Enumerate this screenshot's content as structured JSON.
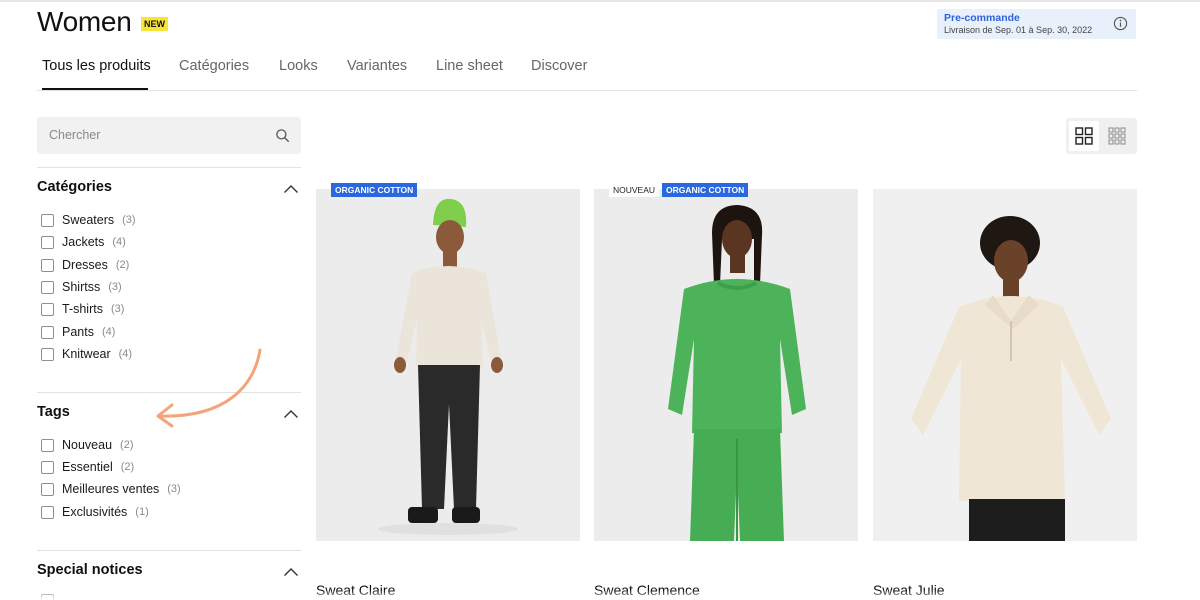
{
  "header": {
    "title": "Women",
    "new_badge": "NEW",
    "preorder": {
      "title": "Pre-commande",
      "subtitle": "Livraison de Sep. 01 à Sep. 30, 2022",
      "icon": "info-icon"
    }
  },
  "tabs": [
    {
      "label": "Tous les produits",
      "active": true
    },
    {
      "label": "Catégories",
      "active": false
    },
    {
      "label": "Looks",
      "active": false
    },
    {
      "label": "Variantes",
      "active": false
    },
    {
      "label": "Line sheet",
      "active": false
    },
    {
      "label": "Discover",
      "active": false
    }
  ],
  "sidebar": {
    "search": {
      "placeholder": "Chercher",
      "value": "",
      "icon": "search-icon"
    },
    "sections": [
      {
        "title": "Catégories",
        "items": [
          {
            "label": "Sweaters",
            "count": "(3)"
          },
          {
            "label": "Jackets",
            "count": "(4)"
          },
          {
            "label": "Dresses",
            "count": "(2)"
          },
          {
            "label": "Shirtss",
            "count": "(3)"
          },
          {
            "label": "T-shirts",
            "count": "(3)"
          },
          {
            "label": "Pants",
            "count": "(4)"
          },
          {
            "label": "Knitwear",
            "count": "(4)"
          }
        ]
      },
      {
        "title": "Tags",
        "items": [
          {
            "label": "Nouveau",
            "count": "(2)"
          },
          {
            "label": "Essentiel",
            "count": "(2)"
          },
          {
            "label": "Meilleures ventes",
            "count": "(3)"
          },
          {
            "label": "Exclusivités",
            "count": "(1)"
          }
        ]
      },
      {
        "title": "Special notices",
        "items": []
      }
    ]
  },
  "view_toggle": {
    "options": [
      "large-grid-icon",
      "small-grid-icon"
    ],
    "selected": "large-grid-icon"
  },
  "products": [
    {
      "name": "Sweat Claire",
      "tags": [
        "ORGANIC COTTON"
      ]
    },
    {
      "name": "Sweat Clemence",
      "tags": [
        "NOUVEAU",
        "ORGANIC COTTON"
      ]
    },
    {
      "name": "Sweat Julie",
      "tags": []
    }
  ],
  "colors": {
    "accent_blue": "#2a68e0",
    "new_badge_yellow": "#f7e33a",
    "annotation_arrow": "#f4a47a"
  }
}
